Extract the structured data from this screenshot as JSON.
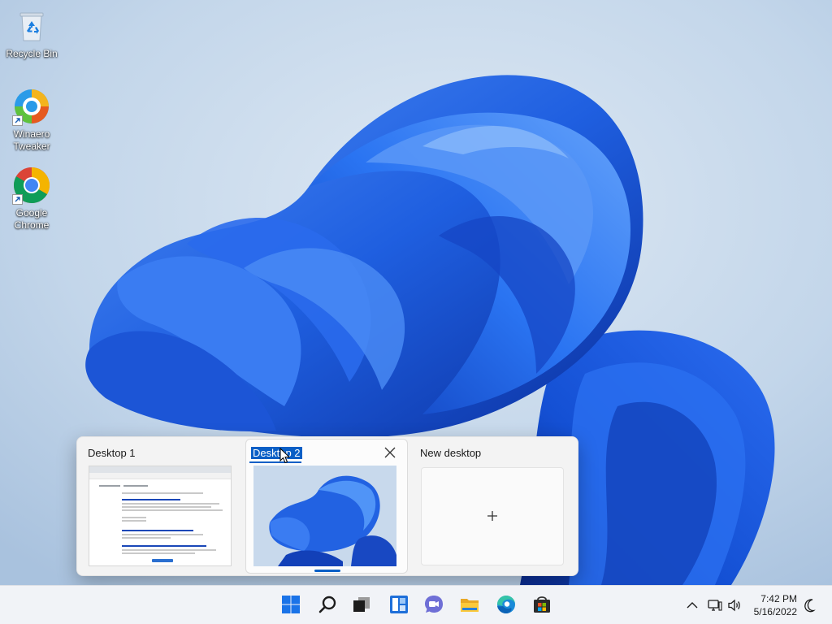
{
  "desktop": {
    "icons": [
      {
        "label_line1": "Recycle Bin",
        "label_line2": "",
        "icon": "recycle-bin-icon"
      },
      {
        "label_line1": "Winaero",
        "label_line2": "Tweaker",
        "icon": "winaero-tweaker-icon",
        "shortcut": true
      },
      {
        "label_line1": "Google",
        "label_line2": "Chrome",
        "icon": "chrome-icon",
        "shortcut": true
      }
    ]
  },
  "task_view": {
    "desktops": [
      {
        "title": "Desktop 1",
        "active": false
      },
      {
        "title": "Desktop 2",
        "active": true,
        "renaming": true
      }
    ],
    "new_desktop_label": "New desktop"
  },
  "taskbar": {
    "apps": [
      "start-icon",
      "search-icon",
      "task-view-icon",
      "widgets-icon",
      "chat-icon",
      "file-explorer-icon",
      "edge-icon",
      "store-icon"
    ],
    "tray": {
      "time": "7:42 PM",
      "date": "5/16/2022",
      "icons": [
        "chevron-up-icon",
        "network-icon",
        "volume-icon",
        "focus-moon-icon"
      ]
    }
  },
  "colors": {
    "accent": "#0a5fc6",
    "wallpaper_bg": "#b9cde4",
    "bloom_blue": "#1f5fe0",
    "taskbar_bg": "#f1f3f7",
    "flyout_bg": "#f3f3f3"
  }
}
